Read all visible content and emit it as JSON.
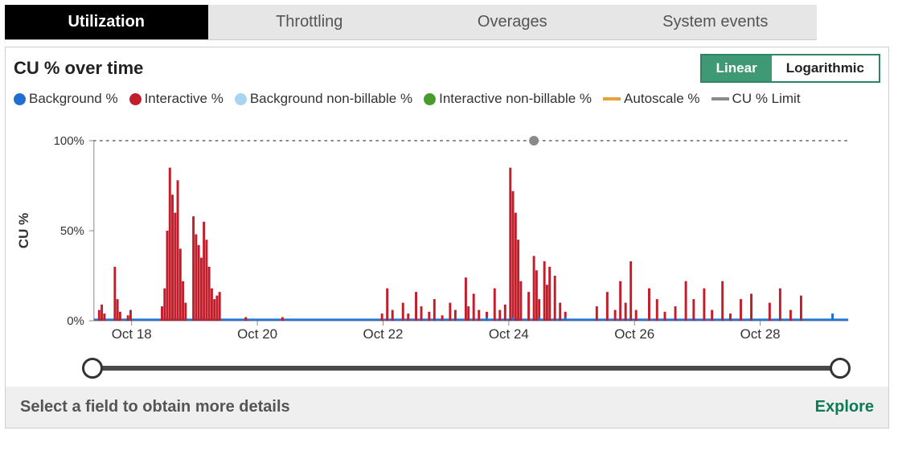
{
  "tabs": [
    {
      "label": "Utilization",
      "active": true
    },
    {
      "label": "Throttling",
      "active": false
    },
    {
      "label": "Overages",
      "active": false
    },
    {
      "label": "System events",
      "active": false
    }
  ],
  "chart_title": "CU % over time",
  "scale_toggle": {
    "linear": "Linear",
    "logarithmic": "Logarithmic",
    "active": "linear"
  },
  "legend": [
    {
      "label": "Background %",
      "color": "#1f6fd1",
      "kind": "dot"
    },
    {
      "label": "Interactive %",
      "color": "#c11d2b",
      "kind": "dot"
    },
    {
      "label": "Background non-billable %",
      "color": "#a9d3f2",
      "kind": "dot"
    },
    {
      "label": "Interactive non-billable %",
      "color": "#4a9b2e",
      "kind": "dot"
    },
    {
      "label": "Autoscale %",
      "color": "#e8a13a",
      "kind": "line"
    },
    {
      "label": "CU % Limit",
      "color": "#8a8a8a",
      "kind": "line"
    }
  ],
  "ylabel": "CU %",
  "footer_hint": "Select a field to obtain more details",
  "explore_label": "Explore",
  "chart_data": {
    "type": "bar",
    "title": "CU % over time",
    "ylabel": "CU %",
    "ylim": [
      0,
      100
    ],
    "yticks": [
      0,
      50,
      100
    ],
    "ytick_labels": [
      "0%",
      "50%",
      "100%"
    ],
    "x_categories": [
      "Oct 18",
      "Oct 20",
      "Oct 22",
      "Oct 24",
      "Oct 26",
      "Oct 28"
    ],
    "x_range_units": 288,
    "x_major_every": 48,
    "cu_limit": 100,
    "marker_at_unit": 168,
    "series": [
      {
        "name": "Interactive %",
        "color": "#c11d2b",
        "values_by_unit": {
          "2": 6,
          "3": 9,
          "4": 4,
          "8": 30,
          "9": 12,
          "10": 5,
          "13": 3,
          "14": 6,
          "26": 8,
          "27": 18,
          "28": 50,
          "29": 85,
          "30": 70,
          "31": 60,
          "32": 78,
          "33": 40,
          "34": 22,
          "35": 10,
          "38": 58,
          "39": 48,
          "40": 42,
          "41": 35,
          "42": 55,
          "43": 45,
          "44": 30,
          "45": 18,
          "46": 12,
          "47": 14,
          "48": 16,
          "58": 2,
          "72": 2,
          "110": 4,
          "112": 18,
          "114": 6,
          "118": 10,
          "120": 4,
          "123": 16,
          "125": 8,
          "128": 5,
          "130": 12,
          "133": 3,
          "136": 10,
          "138": 6,
          "142": 24,
          "143": 8,
          "145": 15,
          "147": 6,
          "150": 5,
          "153": 18,
          "155": 6,
          "157": 9,
          "159": 85,
          "160": 72,
          "161": 60,
          "162": 45,
          "163": 22,
          "166": 16,
          "168": 36,
          "169": 28,
          "170": 12,
          "172": 33,
          "173": 20,
          "174": 30,
          "176": 25,
          "178": 10,
          "180": 5,
          "192": 8,
          "196": 16,
          "199": 6,
          "201": 22,
          "203": 10,
          "205": 33,
          "207": 6,
          "212": 18,
          "215": 12,
          "218": 5,
          "222": 8,
          "226": 22,
          "229": 12,
          "233": 18,
          "236": 6,
          "240": 22,
          "243": 4,
          "247": 12,
          "251": 15,
          "258": 10,
          "262": 18,
          "266": 6,
          "270": 14
        }
      },
      {
        "name": "Background %",
        "color": "#1f6fd1",
        "baseline_value": 1.2,
        "values_by_unit": {
          "150": 2,
          "160": 2,
          "170": 2,
          "180": 2,
          "282": 4
        }
      }
    ]
  }
}
